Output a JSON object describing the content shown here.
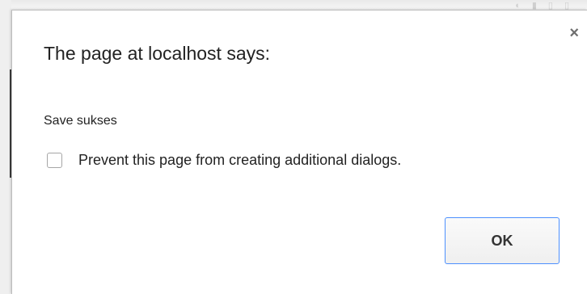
{
  "dialog": {
    "title": "The page at localhost says:",
    "message": "Save sukses",
    "prevent_checkbox": {
      "label": "Prevent this page from creating additional dialogs.",
      "checked": false
    },
    "ok_label": "OK",
    "close_icon": "close-icon",
    "close_glyph": "×"
  },
  "colors": {
    "focus_border": "#4d90fe",
    "text": "#222222"
  }
}
